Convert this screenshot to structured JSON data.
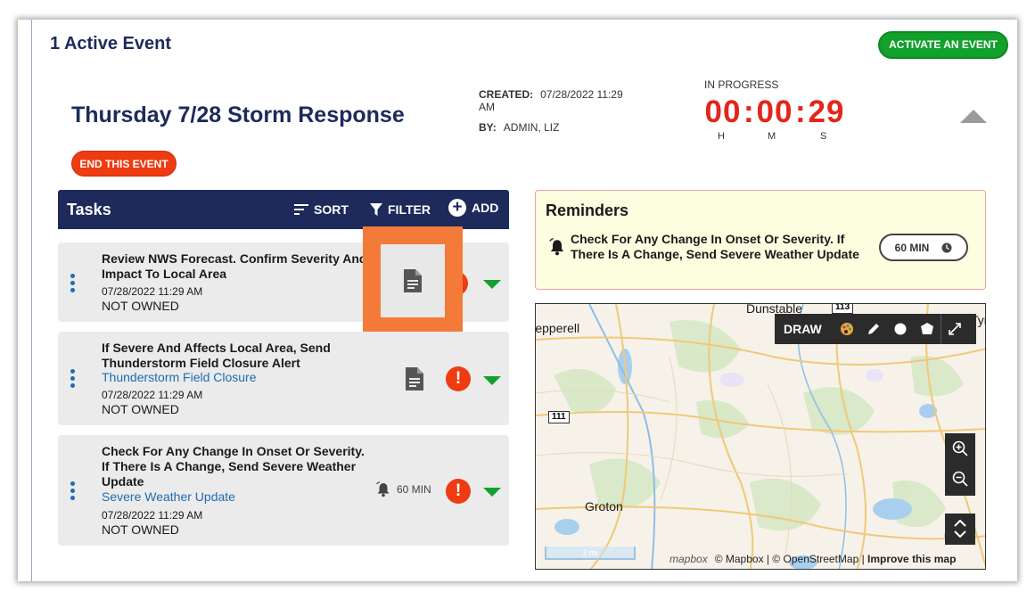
{
  "header": {
    "active_count_title": "1 Active Event",
    "activate_button": "ACTIVATE AN EVENT"
  },
  "event": {
    "title": "Thursday 7/28 Storm Response",
    "created_label": "CREATED:",
    "created_value": "07/28/2022 11:29 AM",
    "by_label": "BY:",
    "by_value": "ADMIN, LIZ",
    "end_button": "END THIS EVENT"
  },
  "timer": {
    "status": "IN PROGRESS",
    "hours": "00",
    "minutes": "00",
    "seconds": "29",
    "h_label": "H",
    "m_label": "M",
    "s_label": "S"
  },
  "tasks": {
    "title": "Tasks",
    "sort_label": "SORT",
    "filter_label": "FILTER",
    "add_label": "ADD",
    "items": [
      {
        "title": "Review NWS Forecast. Confirm Severity And Impact To Local Area",
        "date": "07/28/2022 11:29 AM",
        "owner": "NOT OWNED"
      },
      {
        "title": "If Severe And Affects Local Area, Send Thunderstorm Field Closure Alert",
        "link": "Thunderstorm Field Closure",
        "date": "07/28/2022 11:29 AM",
        "owner": "NOT OWNED"
      },
      {
        "title": "Check For Any Change In Onset Or Severity. If There Is A Change, Send Severe Weather Update",
        "link": "Severe Weather Update",
        "date": "07/28/2022 11:29 AM",
        "owner": "NOT OWNED",
        "reminder": "60 MIN"
      }
    ],
    "alert_glyph": "!"
  },
  "reminders": {
    "title": "Reminders",
    "text": "Check For Any Change In Onset Or Severity. If There Is A Change, Send Severe Weather Update",
    "interval": "60 MIN"
  },
  "map": {
    "draw_label": "DRAW",
    "places": [
      "Dunstable",
      "Pepperell",
      "Tyngsb",
      "Groton"
    ],
    "routes": [
      "113",
      "111"
    ],
    "scale": "2 mi",
    "mapbox_logo": "mapbox",
    "attribution": "© Mapbox | © OpenStreetMap |",
    "improve": "Improve this map"
  },
  "colors": {
    "navy": "#1d2a5b",
    "green": "#12a12b",
    "red": "#ee3b12",
    "highlight": "#f47a3a",
    "link": "#1f6cb0"
  }
}
